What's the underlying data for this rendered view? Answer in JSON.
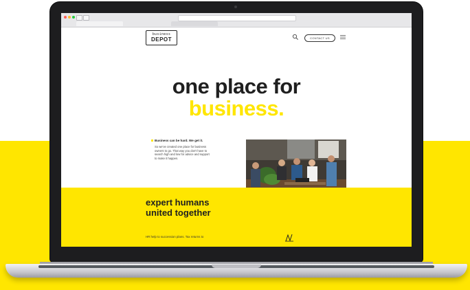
{
  "colors": {
    "brand_yellow": "#ffe600",
    "text_dark": "#1f1f1f",
    "laptop_frame": "#1d1d1f"
  },
  "browser": {
    "url": "",
    "tabs": [
      "",
      ""
    ]
  },
  "header": {
    "logo_top": "business",
    "logo_main": "DEPOT",
    "contact_label": "CONTACT US",
    "icons": [
      "search-icon",
      "menu-icon"
    ]
  },
  "hero": {
    "line1": "one place for",
    "line2": "business."
  },
  "intro": {
    "tagline": "Business can be hard. We get it.",
    "paragraph": "So we've created one place for business owners to go. That way you don't have to search high and low for advice and support to make it happen."
  },
  "yellow_section": {
    "title_line1": "expert humans",
    "title_line2": "united together",
    "text": "HR help to succession plans. Tax returns to"
  }
}
